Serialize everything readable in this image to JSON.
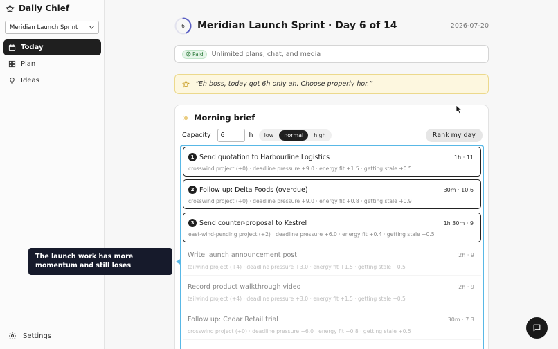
{
  "app": {
    "name": "Daily Chief"
  },
  "sidebar": {
    "plan_select": {
      "value": "Meridian Launch Sprint"
    },
    "items": [
      {
        "label": "Today",
        "icon": "calendar-icon",
        "active": true
      },
      {
        "label": "Plan",
        "icon": "grid-icon",
        "active": false
      },
      {
        "label": "Ideas",
        "icon": "lightbulb-icon",
        "active": false
      }
    ],
    "settings_label": "Settings"
  },
  "header": {
    "day_number": "6",
    "progress": 0.4286,
    "title": "Meridian Launch Sprint · Day 6 of 14",
    "date": "2026-07-20"
  },
  "paid": {
    "badge": "Paid",
    "text": "Unlimited plans, chat, and media"
  },
  "quote": {
    "text": "“Eh boss, today got 6h only ah. Choose properly hor.”"
  },
  "brief": {
    "title": "Morning brief",
    "capacity_label": "Capacity",
    "capacity_value": "6",
    "capacity_unit": "h",
    "energy_options": [
      "low",
      "normal",
      "high"
    ],
    "energy_selected": "normal",
    "rank_label": "Rank my day",
    "tasks": [
      {
        "rank": "1",
        "title": "Send quotation to Harbourline Logistics",
        "meta": "1h · 11",
        "reason": "crosswind project (+0) · deadline pressure +9.0 · energy fit +1.5 · getting stale +0.5"
      },
      {
        "rank": "2",
        "title": "Follow up: Delta Foods (overdue)",
        "meta": "30m · 10.6",
        "reason": "crosswind project (+0) · deadline pressure +9.0 · energy fit +0.8 · getting stale +0.9"
      },
      {
        "rank": "3",
        "title": "Send counter-proposal to Kestrel",
        "meta": "1h 30m · 9",
        "reason": "east-wind-pending project (+2) · deadline pressure +6.0 · energy fit +0.4 · getting stale +0.5"
      },
      {
        "rank": "",
        "title": "Write launch announcement post",
        "meta": "2h · 9",
        "reason": "tailwind project (+4) · deadline pressure +3.0 · energy fit +1.5 · getting stale +0.5"
      },
      {
        "rank": "",
        "title": "Record product walkthrough video",
        "meta": "2h · 9",
        "reason": "tailwind project (+4) · deadline pressure +3.0 · energy fit +1.5 · getting stale +0.5"
      },
      {
        "rank": "",
        "title": "Follow up: Cedar Retail trial",
        "meta": "30m · 7.3",
        "reason": "crosswind project (+0) · deadline pressure +6.0 · energy fit +0.8 · getting stale +0.5"
      }
    ]
  },
  "callout": {
    "text": "The launch work has more momentum and still loses"
  },
  "colors": {
    "accent": "#59b8e6",
    "dark": "#1f1f1f",
    "callout_bg": "#161a2b",
    "quote_bg": "#fdf7df"
  }
}
